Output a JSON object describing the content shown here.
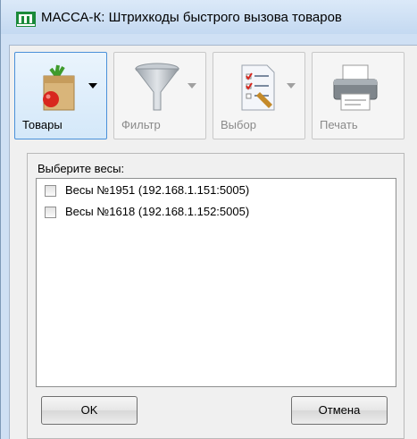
{
  "window": {
    "title": "МАССА-К: Штрихкоды быстрого вызова товаров"
  },
  "toolbar": {
    "buttons": [
      {
        "label": "Товары",
        "icon": "groceries-bag-icon",
        "enabled": true
      },
      {
        "label": "Фильтр",
        "icon": "funnel-filter-icon",
        "enabled": false
      },
      {
        "label": "Выбор",
        "icon": "checklist-icon",
        "enabled": false
      },
      {
        "label": "Печать",
        "icon": "printer-icon",
        "enabled": false
      }
    ]
  },
  "scales_panel": {
    "label": "Выберите весы:",
    "items": [
      {
        "label": "Весы №1951 (192.168.1.151:5005)",
        "checked": false
      },
      {
        "label": "Весы №1618 (192.168.1.152:5005)",
        "checked": false
      }
    ]
  },
  "dialog_buttons": {
    "ok": "OK",
    "cancel": "Отмена"
  },
  "colors": {
    "titlebar": "#cfe0f4",
    "active_border": "#4a90d9",
    "background": "#f0f0f0"
  }
}
